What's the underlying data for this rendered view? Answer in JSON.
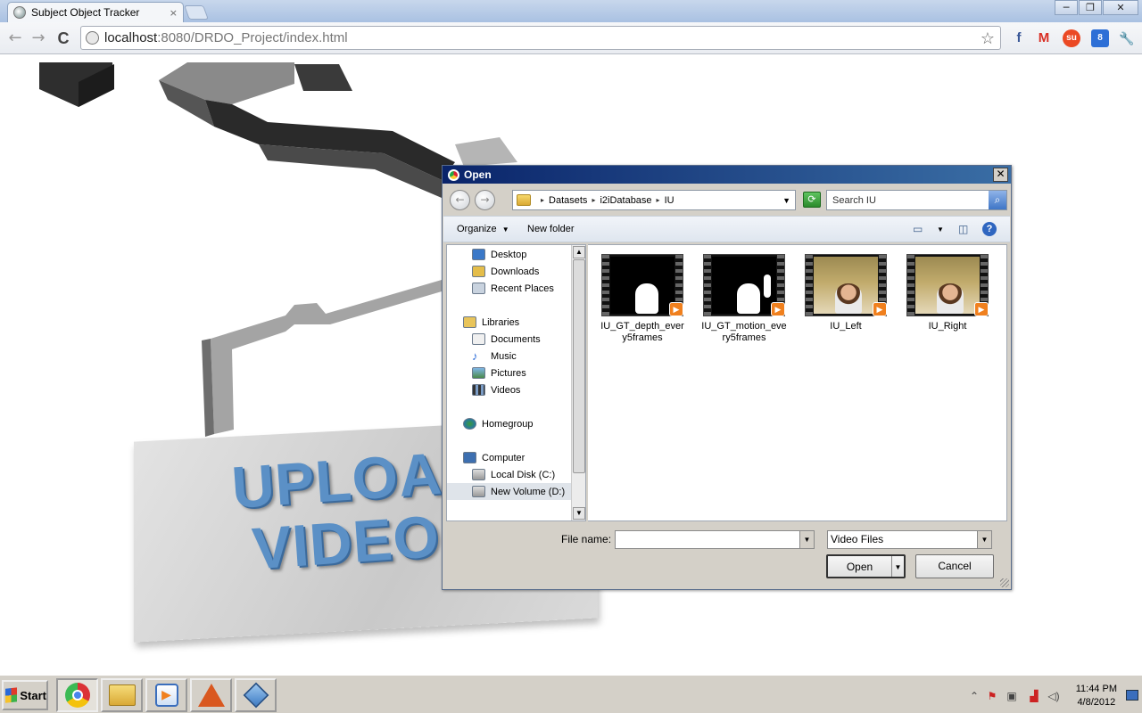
{
  "browser": {
    "tab_title": "Subject Object Tracker",
    "tab_close": "×",
    "url_host": "localhost",
    "url_rest": ":8080/DRDO_Project/index.html",
    "back": "←",
    "forward": "→",
    "reload": "C",
    "bookmark_star": "☆",
    "window": {
      "minimize": "─",
      "maximize": "❐",
      "close": "✕"
    },
    "extensions": [
      {
        "icon": "facebook-icon",
        "glyph": "f",
        "color": "#3b5998"
      },
      {
        "icon": "gmail-icon",
        "glyph": "M",
        "color": "#d93025"
      },
      {
        "icon": "stumbleupon-icon",
        "glyph": "su",
        "color": "#eb4924"
      },
      {
        "icon": "notification-icon",
        "glyph": "8",
        "color": "#2d6fd6"
      },
      {
        "icon": "wrench-icon",
        "glyph": "🔧",
        "color": "#555"
      }
    ]
  },
  "page": {
    "sign_line1": "UPLOAD",
    "sign_line2": "VIDEO"
  },
  "dialog": {
    "title": "Open",
    "close": "✕",
    "breadcrumb": [
      "Datasets",
      "i2iDatabase",
      "IU"
    ],
    "search_placeholder": "Search IU",
    "organize": "Organize",
    "new_folder": "New folder",
    "nav": {
      "favorites": [
        "Desktop",
        "Downloads",
        "Recent Places"
      ],
      "libraries": "Libraries",
      "library_items": [
        "Documents",
        "Music",
        "Pictures",
        "Videos"
      ],
      "homegroup": "Homegroup",
      "computer": "Computer",
      "drives": [
        "Local Disk (C:)",
        "New Volume (D:)"
      ]
    },
    "files": [
      {
        "name": "IU_GT_depth_every5frames",
        "line1": "IU_GT_depth_ever",
        "line2": "y5frames"
      },
      {
        "name": "IU_GT_motion_every5frames",
        "line1": "IU_GT_motion_eve",
        "line2": "ry5frames"
      },
      {
        "name": "IU_Left",
        "line1": "IU_Left",
        "line2": ""
      },
      {
        "name": "IU_Right",
        "line1": "IU_Right",
        "line2": ""
      }
    ],
    "file_name_label": "File name:",
    "file_name_value": "",
    "file_type": "Video Files",
    "open_button": "Open",
    "cancel_button": "Cancel"
  },
  "taskbar": {
    "start": "Start",
    "clock_time": "11:44 PM",
    "clock_date": "4/8/2012",
    "apps": [
      "chrome-icon",
      "explorer-icon",
      "media-player-icon",
      "matlab-icon",
      "virtualbox-icon"
    ]
  }
}
